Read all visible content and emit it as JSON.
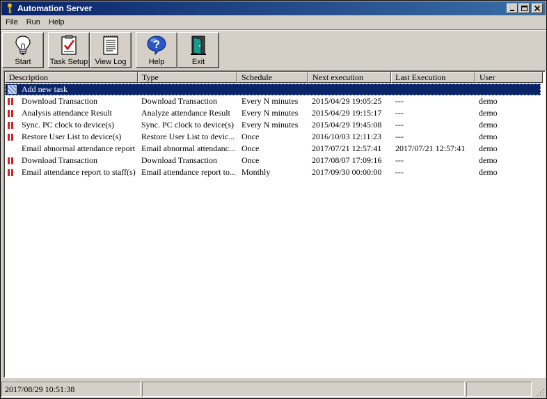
{
  "window": {
    "title": "Automation Server"
  },
  "menu": [
    "File",
    "Run",
    "Help"
  ],
  "toolbar": [
    {
      "label": "Start",
      "icon": "lightbulb-icon"
    },
    {
      "label": "Task Setup",
      "icon": "clipboard-check-icon"
    },
    {
      "label": "View Log",
      "icon": "log-document-icon"
    },
    {
      "label": "Help",
      "icon": "help-question-icon"
    },
    {
      "label": "Exit",
      "icon": "exit-door-icon"
    }
  ],
  "columns": [
    "Description",
    "Type",
    "Schedule",
    "Next execution",
    "Last Execution",
    "User"
  ],
  "add_row_label": "Add new task",
  "tasks": [
    {
      "description": "Download Transaction",
      "type": "Download Transaction",
      "schedule": "Every N minutes",
      "next": "2015/04/29 19:05:25",
      "last": "---",
      "user": "demo",
      "paused": true
    },
    {
      "description": "Analysis attendance Result",
      "type": "Analyze attendance Result",
      "schedule": "Every N minutes",
      "next": "2015/04/29 19:15:17",
      "last": "---",
      "user": "demo",
      "paused": true
    },
    {
      "description": "Sync. PC clock to device(s)",
      "type": "Sync. PC clock to device(s)",
      "schedule": "Every N minutes",
      "next": "2015/04/29 19:45:08",
      "last": "---",
      "user": "demo",
      "paused": true
    },
    {
      "description": "Restore User List to device(s)",
      "type": "Restore User List to devic...",
      "schedule": "Once",
      "next": "2016/10/03 12:11:23",
      "last": "---",
      "user": "demo",
      "paused": true
    },
    {
      "description": "Email abnormal attendance report",
      "type": "Email abnormal attendanc...",
      "schedule": "Once",
      "next": "2017/07/21 12:57:41",
      "last": "2017/07/21 12:57:41",
      "user": "demo",
      "paused": false
    },
    {
      "description": "Download Transaction",
      "type": "Download Transaction",
      "schedule": "Once",
      "next": "2017/08/07 17:09:16",
      "last": "---",
      "user": "demo",
      "paused": true
    },
    {
      "description": "Email attendance report to staff(s)",
      "type": "Email attendance report to...",
      "schedule": "Monthly",
      "next": "2017/09/30 00:00:00",
      "last": "---",
      "user": "demo",
      "paused": true
    }
  ],
  "colors": {
    "pause_icon": "#d81e1e",
    "selection": "#0a246a",
    "titlebar": "#0a246a"
  },
  "status": {
    "datetime": "2017/08/29 10:51:38"
  }
}
